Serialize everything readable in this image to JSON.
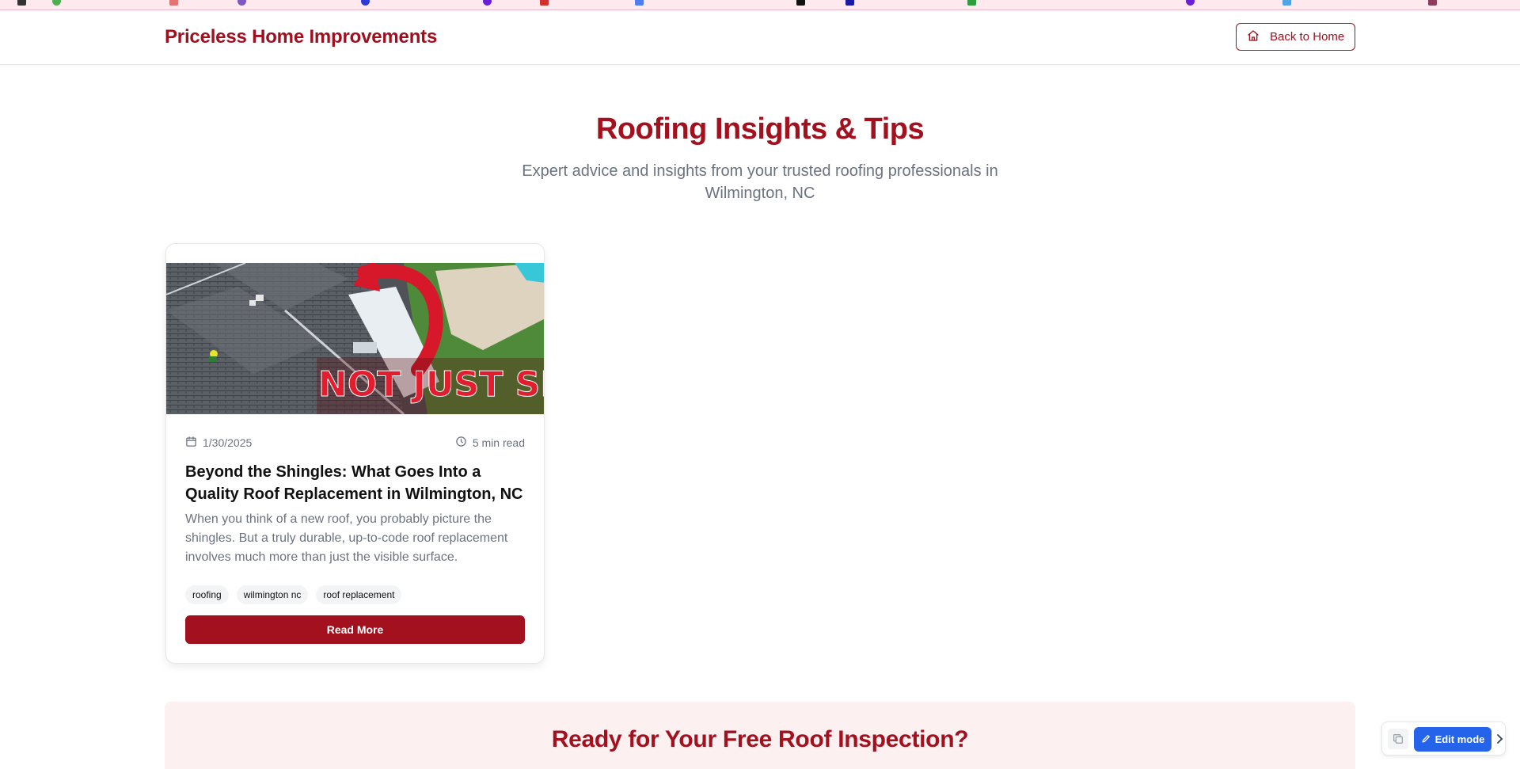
{
  "header": {
    "brand": "Priceless Home Improvements",
    "back_button_label": "Back to Home"
  },
  "hero": {
    "title": "Roofing Insights & Tips",
    "subtitle": "Expert advice and insights from your trusted roofing professionals in Wilmington, NC"
  },
  "posts": [
    {
      "image_text": "NOT JUST SHINGLES",
      "date": "1/30/2025",
      "read_time": "5 min read",
      "title": "Beyond the Shingles: What Goes Into a Quality Roof Replacement in Wilmington, NC",
      "excerpt": "When you think of a new roof, you probably picture the shingles. But a truly durable, up-to-code roof replacement involves much more than just the visible surface.",
      "tags": [
        "roofing",
        "wilmington nc",
        "roof replacement"
      ],
      "button_label": "Read More"
    }
  ],
  "cta": {
    "title": "Ready for Your Free Roof Inspection?"
  },
  "edit_widget": {
    "edit_mode_label": "Edit mode"
  },
  "colors": {
    "brand": "#a3101e",
    "cta_background": "#fdf0f1",
    "edit_button": "#2563eb"
  },
  "icons": [
    "home-icon",
    "calendar-icon",
    "clock-icon",
    "pencil-icon",
    "chevron-right-icon",
    "copy-icon"
  ]
}
